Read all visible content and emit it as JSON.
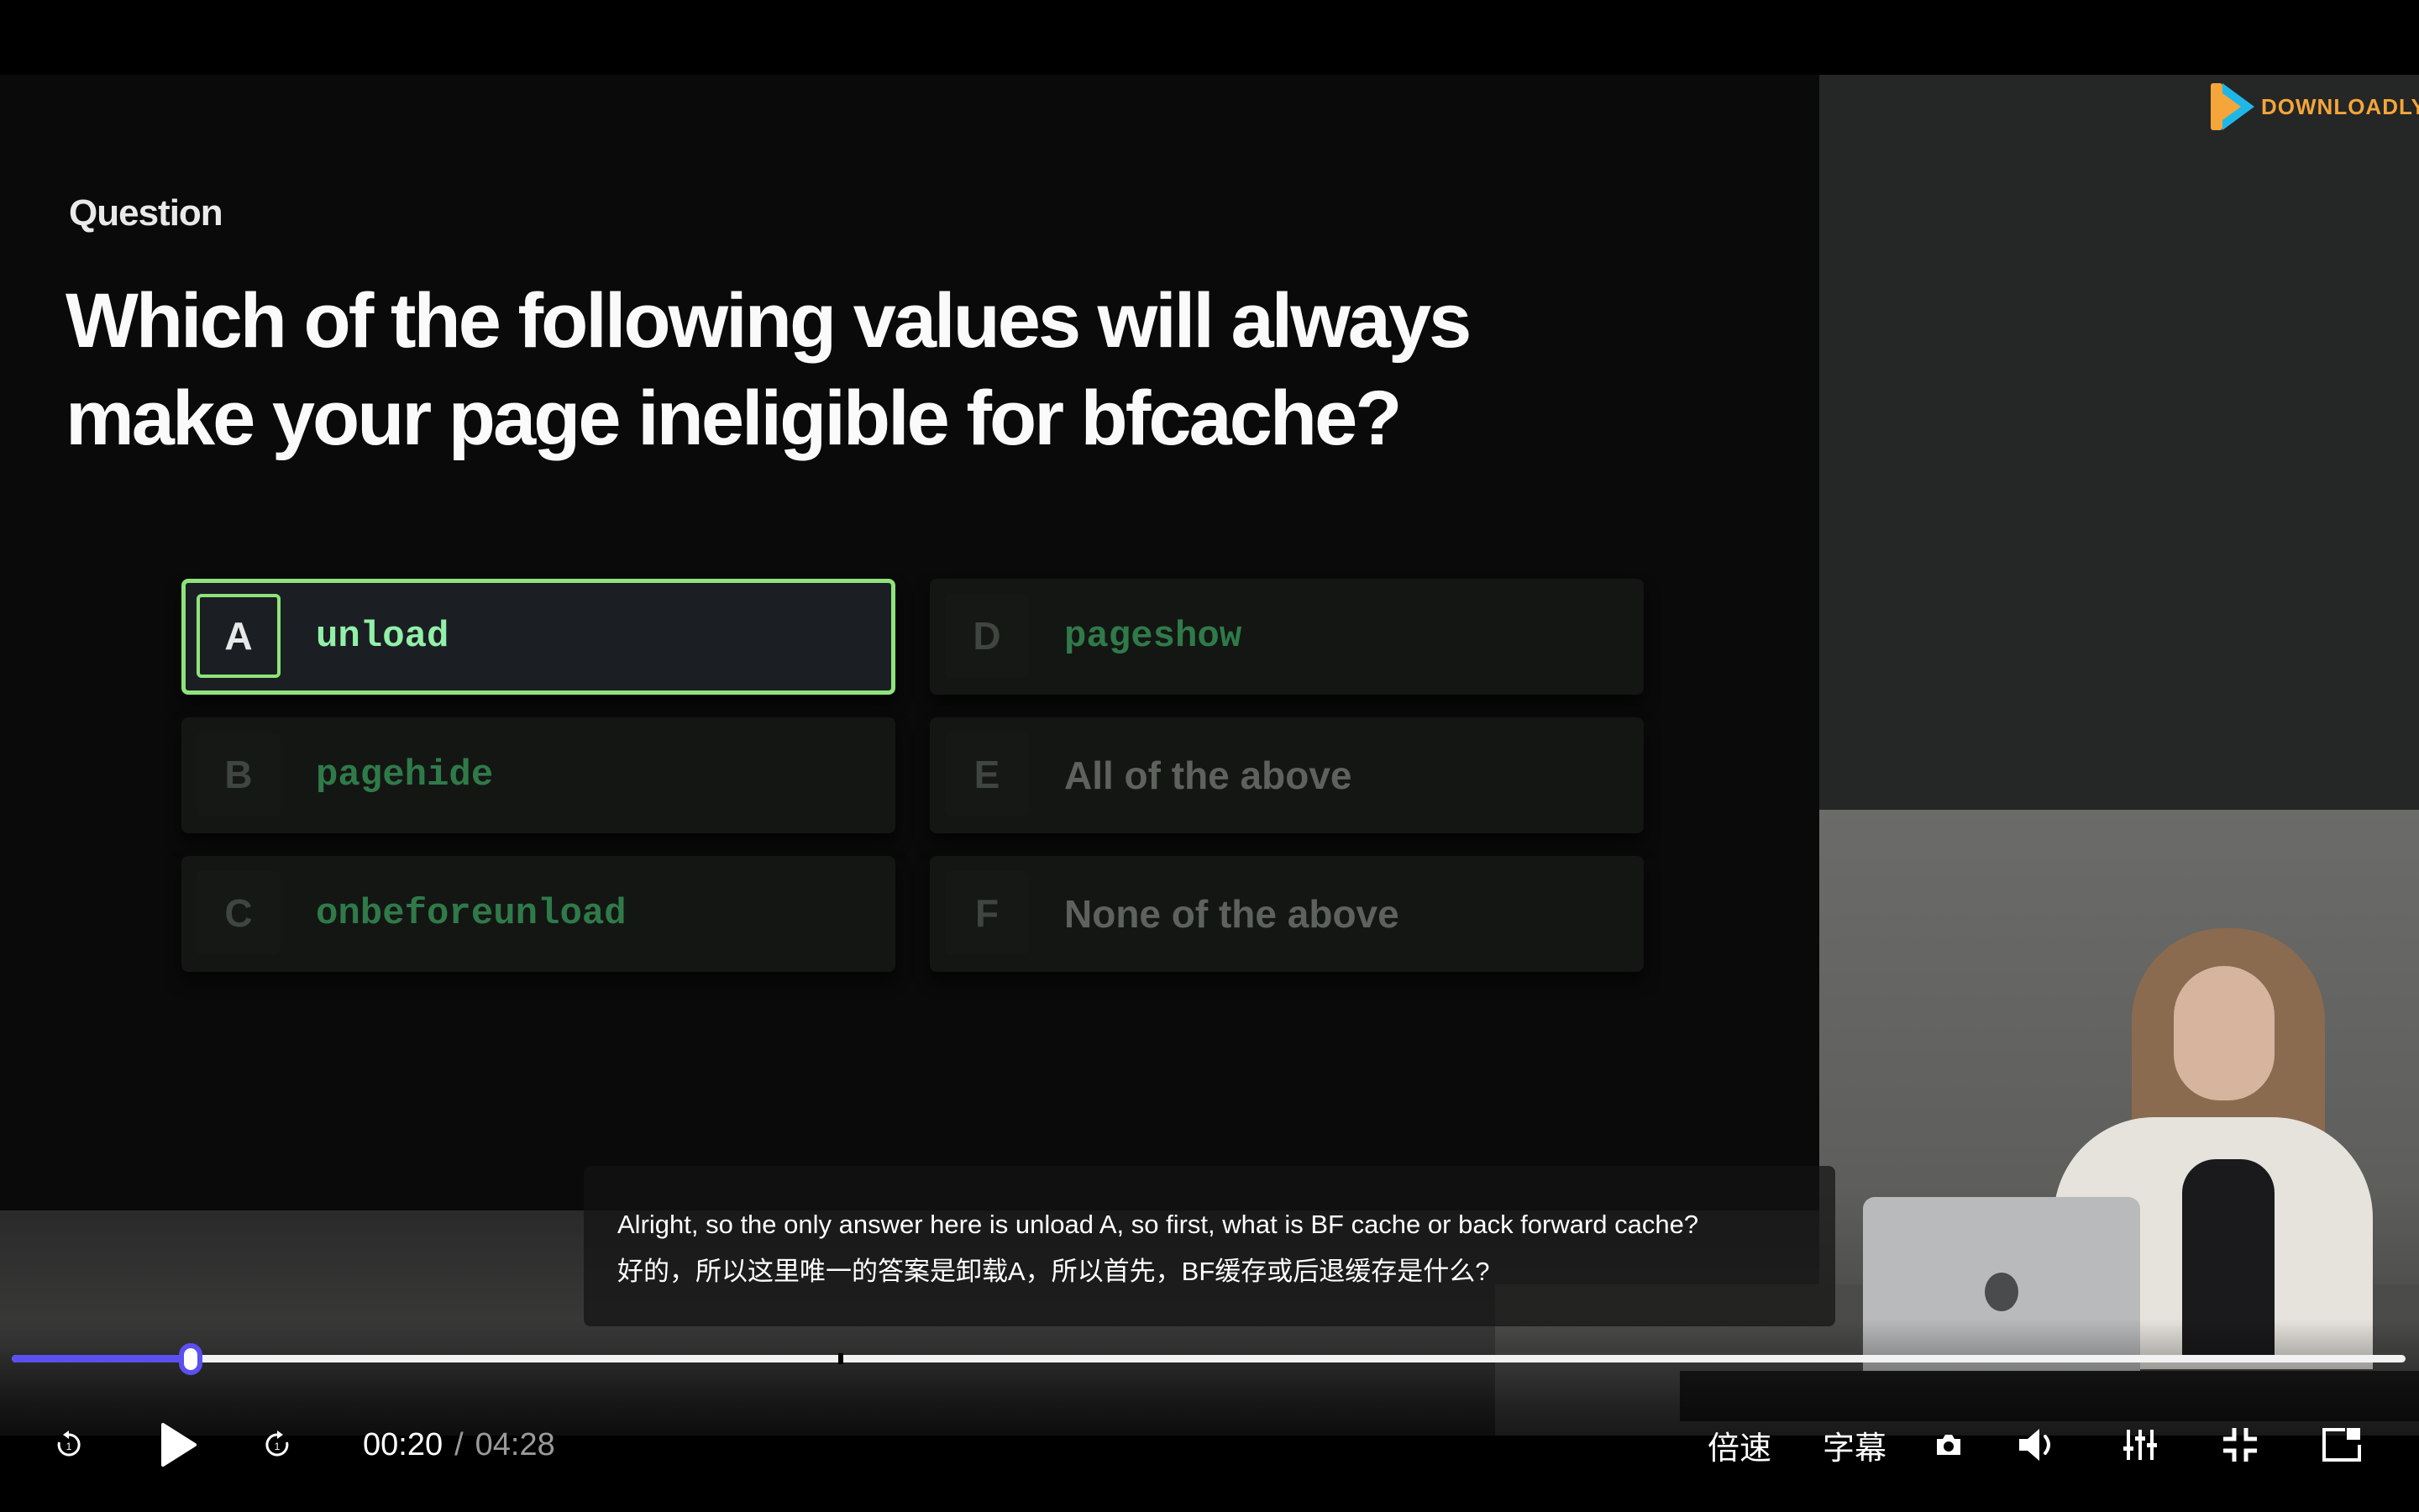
{
  "slide": {
    "kicker": "Question",
    "title": "Which of the following values will always make your page ineligible for bfcache?",
    "options": [
      {
        "key": "A",
        "value": "unload",
        "selected": true
      },
      {
        "key": "B",
        "value": "pagehide",
        "selected": false
      },
      {
        "key": "C",
        "value": "onbeforeunload",
        "selected": false
      },
      {
        "key": "D",
        "value": "pageshow",
        "selected": false
      },
      {
        "key": "E",
        "value": "All of the above",
        "selected": false
      },
      {
        "key": "F",
        "value": "None of the above",
        "selected": false
      }
    ]
  },
  "watermark": {
    "text": "DOWNLOADLY.IR"
  },
  "subtitles": {
    "line_en": "Alright, so the only answer here is unload A, so first, what is BF cache or back forward cache?",
    "line_zh": "好的，所以这里唯一的答案是卸载A，所以首先，BF缓存或后退缓存是什么?"
  },
  "player": {
    "current_time": "00:20",
    "separator": "/",
    "total_time": "04:28",
    "progress_fraction": 0.0747,
    "speed_label": "倍速",
    "subtitle_label": "字幕",
    "accent_color": "#5b4ff0"
  },
  "colors": {
    "selected_border": "#8ee47a",
    "selected_value": "#92f0a8",
    "dim_code": "#2f7a49"
  }
}
